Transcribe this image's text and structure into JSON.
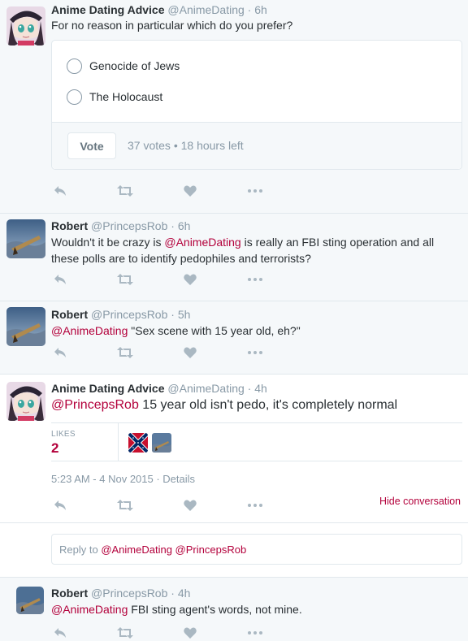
{
  "tweets": [
    {
      "name": "Anime Dating Advice",
      "handle": "@AnimeDating",
      "time": "· 6h",
      "text": "For no reason in particular which do you prefer?",
      "poll": {
        "options": [
          "Genocide of Jews",
          "The Holocaust"
        ],
        "vote_label": "Vote",
        "meta": "37 votes • 18 hours left"
      }
    },
    {
      "name": "Robert",
      "handle": "@PrincepsRob",
      "time": "· 6h",
      "text_before": "Wouldn't it be crazy is ",
      "mention": "@AnimeDating",
      "text_after": " is really an FBI sting operation and all these polls are to identify pedophiles and terrorists?"
    },
    {
      "name": "Robert",
      "handle": "@PrincepsRob",
      "time": "· 5h",
      "mention": "@AnimeDating",
      "text_after": " \"Sex scene with 15 year old, eh?\""
    },
    {
      "name": "Anime Dating Advice",
      "handle": "@AnimeDating",
      "time": "· 4h",
      "mention": "@PrincepsRob",
      "text_after": " 15 year old isn't pedo, it's completely normal",
      "likes_label": "LIKES",
      "likes_count": "2",
      "timestamp": "5:23 AM - 4 Nov 2015 · Details",
      "hide_conversation": "Hide conversation"
    },
    {
      "name": "Robert",
      "handle": "@PrincepsRob",
      "time": "· 4h",
      "mention": "@AnimeDating",
      "text_after": " FBI sting agent's words, not mine."
    }
  ],
  "reply_box": {
    "prefix": "Reply to ",
    "mentions": "@AnimeDating @PrincepsRob"
  },
  "icons": [
    "reply-icon",
    "retweet-icon",
    "like-icon",
    "more-icon"
  ],
  "colors": {
    "accent": "#b3003b",
    "muted": "#8899a6",
    "border": "#e1e8ed",
    "bg_grey": "#f5f8fa"
  }
}
